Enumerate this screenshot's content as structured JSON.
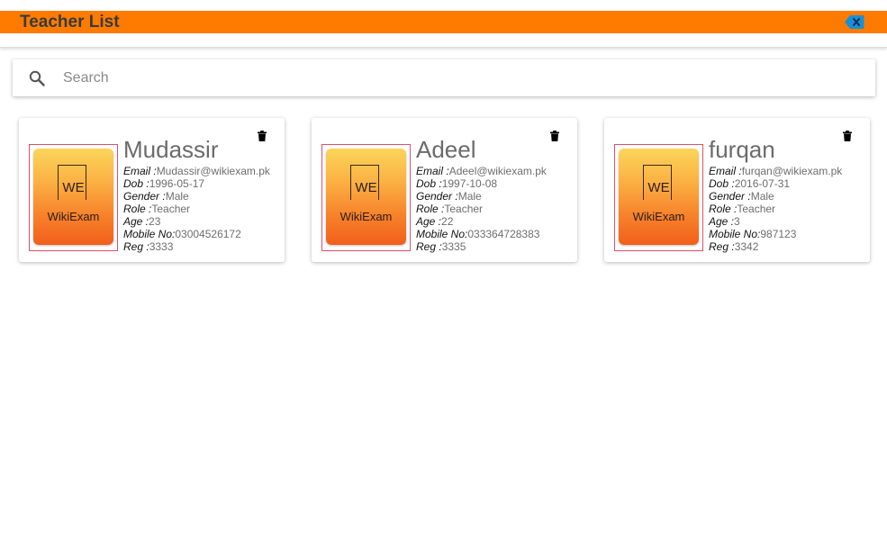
{
  "header": {
    "title": "Teacher List",
    "close_icon": "backspace-icon",
    "bar_color": "#ff7b00",
    "close_color": "#1a8fd6"
  },
  "search": {
    "placeholder": "Search",
    "value": ""
  },
  "labels": {
    "email": "Email :",
    "dob": "Dob :",
    "gender": "Gender :",
    "role": "Role :",
    "age": "Age :",
    "mobile": "Mobile No:",
    "reg": "Reg :"
  },
  "logo": {
    "mark": "WE",
    "brand": "WikiExam"
  },
  "teachers": [
    {
      "name": "Mudassir",
      "email": "Mudassir@wikiexam.pk",
      "dob": "1996-05-17",
      "gender": "Male",
      "role": "Teacher",
      "age": "23",
      "mobile": "03004526172",
      "reg": "3333"
    },
    {
      "name": "Adeel",
      "email": "Adeel@wikiexam.pk",
      "dob": "1997-10-08",
      "gender": "Male",
      "role": "Teacher",
      "age": "22",
      "mobile": "033364728383",
      "reg": "3335"
    },
    {
      "name": "furqan",
      "email": "furqan@wikiexam.pk",
      "dob": "2016-07-31",
      "gender": "Male",
      "role": "Teacher",
      "age": "3",
      "mobile": "987123",
      "reg": "3342"
    }
  ]
}
